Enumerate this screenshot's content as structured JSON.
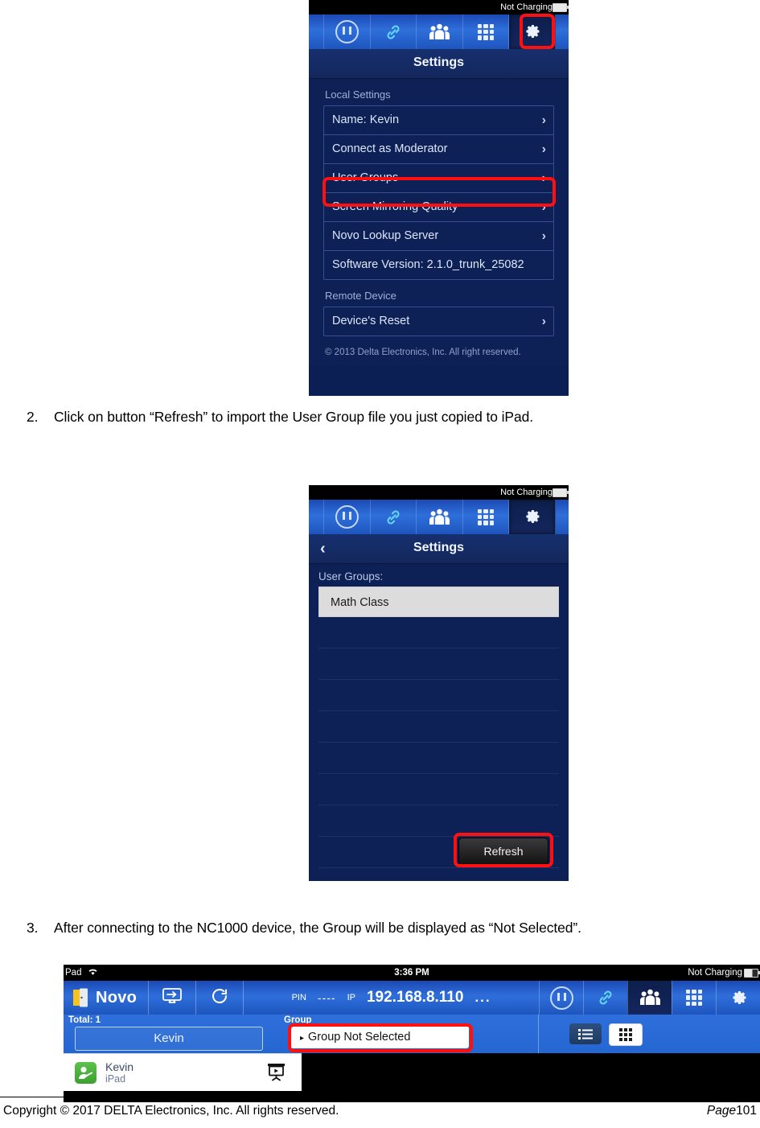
{
  "document": {
    "steps": [
      {
        "num": "2.",
        "text": "Click on button “Refresh” to import the User Group file you just copied to iPad."
      },
      {
        "num": "3.",
        "text": "After connecting to the NC1000 device, the Group will be displayed as “Not Selected”."
      }
    ],
    "footer": {
      "copyright": "Copyright © 2017 DELTA Electronics, Inc. All rights reserved.",
      "page_label": "Page",
      "page_number": "101"
    }
  },
  "screenshot1": {
    "statusbar": {
      "right": "Not Charging"
    },
    "tabs": [
      {
        "name": "pause-icon",
        "active": false
      },
      {
        "name": "link-icon",
        "active": false
      },
      {
        "name": "people-icon",
        "active": false
      },
      {
        "name": "grid-icon",
        "active": false
      },
      {
        "name": "gear-icon",
        "active": true
      }
    ],
    "nav_title": "Settings",
    "sections": [
      {
        "label": "Local Settings",
        "rows": [
          {
            "label": "Name: Kevin",
            "chevron": "›",
            "highlight": false
          },
          {
            "label": "Connect as Moderator",
            "chevron": "›",
            "highlight": false
          },
          {
            "label": "User Groups",
            "chevron": "›",
            "highlight": true
          },
          {
            "label": "Screen Mirroring Quality",
            "chevron": "›",
            "highlight": false
          },
          {
            "label": "Novo Lookup Server",
            "chevron": "›",
            "highlight": false
          },
          {
            "label": "Software Version: 2.1.0_trunk_25082",
            "chevron": "",
            "highlight": false
          }
        ]
      },
      {
        "label": "Remote Device",
        "rows": [
          {
            "label": "Device's Reset",
            "chevron": "›",
            "highlight": false
          }
        ]
      }
    ],
    "copyright": "© 2013 Delta Electronics, Inc. All right reserved."
  },
  "screenshot2": {
    "statusbar": {
      "right": "Not Charging"
    },
    "nav_title": "Settings",
    "back_icon": "‹",
    "list_label": "User Groups:",
    "groups": [
      "Math Class"
    ],
    "refresh_button": "Refresh"
  },
  "screenshot3": {
    "statusbar": {
      "left": "Pad",
      "center": "3:36 PM",
      "right": "Not Charging"
    },
    "brand": "Novo",
    "pin_label": "PIN",
    "pin_value": "----",
    "ip_label": "IP",
    "ip_value": "192.168.8.110",
    "more": "...",
    "total_label": "Total: 1",
    "user_name": "Kevin",
    "group_label": "Group",
    "group_value": "Group Not Selected",
    "group_caret": "▸",
    "card": {
      "name": "Kevin",
      "device": "iPad"
    }
  },
  "colors": {
    "highlight_red": "#ff1010",
    "ios_blue": "#2f6fdb",
    "panel_navy": "#0d2157",
    "avatar_green": "#4cb03c"
  }
}
